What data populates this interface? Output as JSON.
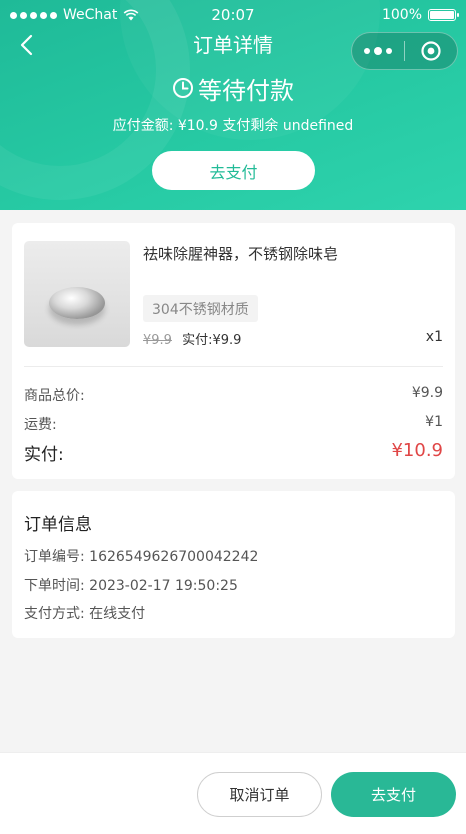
{
  "status_bar": {
    "carrier": "WeChat",
    "time": "20:07",
    "battery": "100%"
  },
  "nav": {
    "title": "订单详情"
  },
  "order_status": {
    "label": "等待付款",
    "pay_info": "应付金额: ¥10.9 支付剩余 undefined",
    "pay_button": "去支付"
  },
  "product": {
    "name": "祛味除腥神器，不锈钢除味皂",
    "spec": "304不锈钢材质",
    "original_price": "¥9.9",
    "paid_price": "实付:¥9.9",
    "quantity": "x1"
  },
  "summary": {
    "items_total_label": "商品总价:",
    "items_total_value": "¥9.9",
    "shipping_label": "运费:",
    "shipping_value": "¥1",
    "paid_label": "实付:",
    "paid_value": "¥10.9"
  },
  "order_info": {
    "title": "订单信息",
    "order_no": "订单编号: 1626549626700042242",
    "order_time": "下单时间: 2023-02-17 19:50:25",
    "pay_method": "支付方式: 在线支付"
  },
  "bottom_bar": {
    "cancel_label": "取消订单",
    "pay_label": "去支付"
  },
  "colors": {
    "brand": "#26c9a3",
    "pay_button": "#29b896",
    "price_red": "#e04646"
  }
}
